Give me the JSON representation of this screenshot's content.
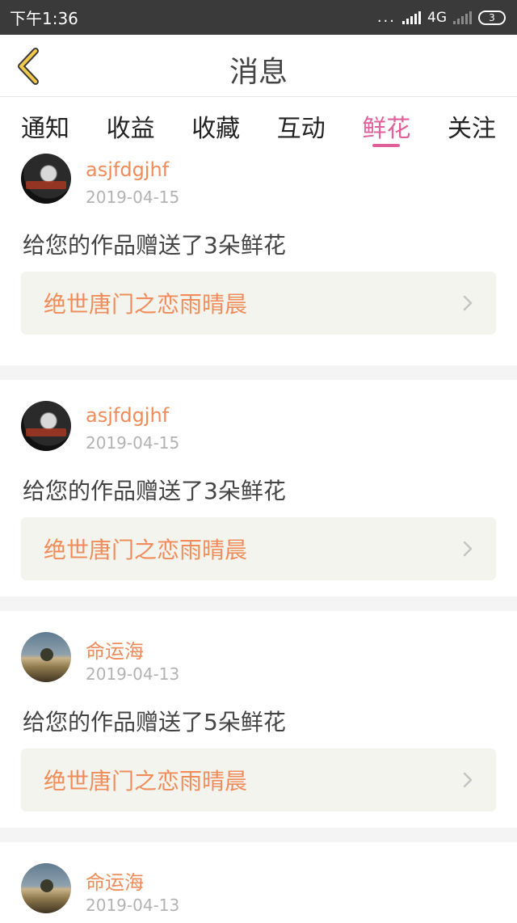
{
  "status": {
    "time": "下午1:36",
    "dots": "...",
    "network": "4G",
    "battery": "3"
  },
  "header": {
    "title": "消息"
  },
  "tabs": [
    {
      "label": "通知",
      "active": false
    },
    {
      "label": "收益",
      "active": false
    },
    {
      "label": "收藏",
      "active": false
    },
    {
      "label": "互动",
      "active": false
    },
    {
      "label": "鲜花",
      "active": true
    },
    {
      "label": "关注",
      "active": false
    }
  ],
  "colors": {
    "accent_pink": "#e0609a",
    "orange_text": "#f08c5a",
    "status_bar": "#3a3a3a",
    "box_bg": "#f4f4ef"
  },
  "items": [
    {
      "user": "asjfdgjhf",
      "date": "2019-04-15",
      "message": "给您的作品赠送了3朵鲜花",
      "work": "绝世唐门之恋雨晴晨",
      "avatar": "woman-avatar"
    },
    {
      "user": "asjfdgjhf",
      "date": "2019-04-15",
      "message": "给您的作品赠送了3朵鲜花",
      "work": "绝世唐门之恋雨晴晨",
      "avatar": "woman-avatar"
    },
    {
      "user": "命运海",
      "date": "2019-04-13",
      "message": "给您的作品赠送了5朵鲜花",
      "work": "绝世唐门之恋雨晴晨",
      "avatar": "landscape-avatar"
    },
    {
      "user": "命运海",
      "date": "2019-04-13",
      "avatar": "landscape-avatar"
    }
  ],
  "icons": {
    "back": "back-chevron-icon",
    "row_arrow": "chevron-right-icon"
  }
}
